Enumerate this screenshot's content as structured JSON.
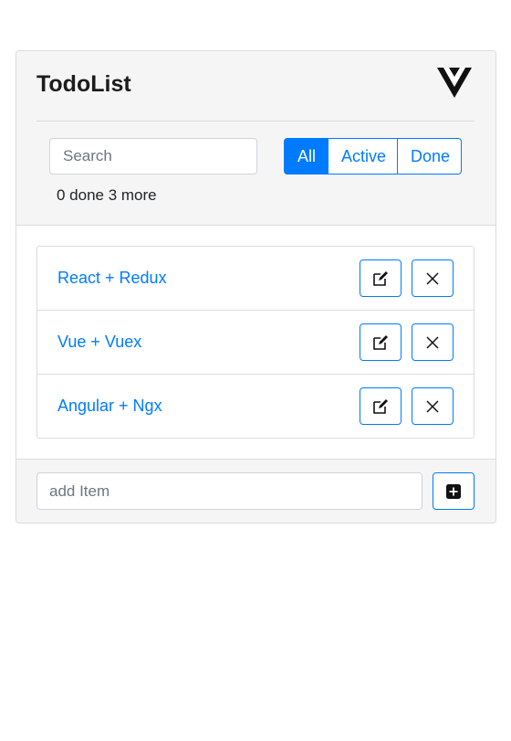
{
  "app": {
    "title": "TodoList",
    "logo_icon": "vue-logo-icon"
  },
  "search": {
    "placeholder": "Search",
    "value": ""
  },
  "filters": [
    {
      "label": "All",
      "active": true
    },
    {
      "label": "Active",
      "active": false
    },
    {
      "label": "Done",
      "active": false
    }
  ],
  "status": {
    "text": "0 done 3 more",
    "done_count": 0,
    "remaining_count": 3
  },
  "todos": [
    {
      "label": "React + Redux",
      "edit_icon": "edit-icon",
      "delete_icon": "close-icon"
    },
    {
      "label": "Vue + Vuex",
      "edit_icon": "edit-icon",
      "delete_icon": "close-icon"
    },
    {
      "label": "Angular + Ngx",
      "edit_icon": "edit-icon",
      "delete_icon": "close-icon"
    }
  ],
  "add_item": {
    "placeholder": "add Item",
    "value": "",
    "button_icon": "plus-square-icon"
  },
  "colors": {
    "accent": "#007bff",
    "header_bg": "#f5f5f5",
    "border": "#dcdcdc"
  }
}
